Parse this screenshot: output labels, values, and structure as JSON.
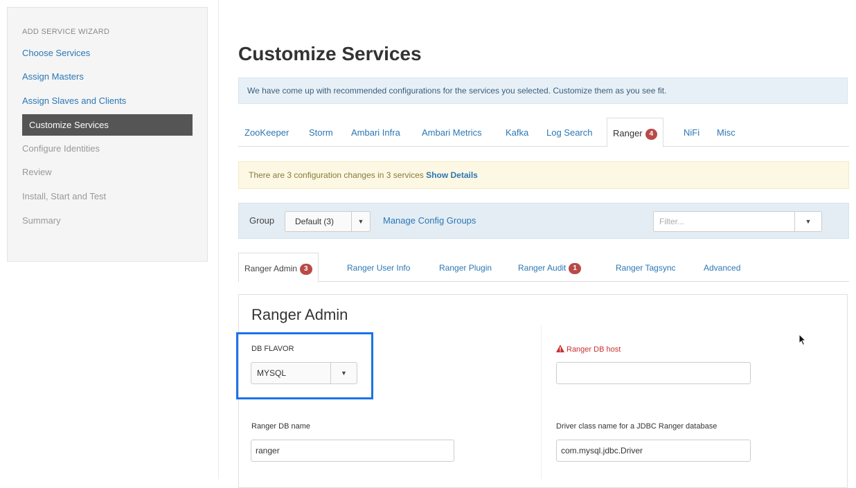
{
  "sidebar": {
    "title": "ADD SERVICE WIZARD",
    "steps": [
      {
        "label": "Choose Services",
        "state": "done"
      },
      {
        "label": "Assign Masters",
        "state": "done"
      },
      {
        "label": "Assign Slaves and Clients",
        "state": "done"
      },
      {
        "label": "Customize Services",
        "state": "active"
      },
      {
        "label": "Configure Identities",
        "state": "todo"
      },
      {
        "label": "Review",
        "state": "todo"
      },
      {
        "label": "Install, Start and Test",
        "state": "todo"
      },
      {
        "label": "Summary",
        "state": "todo"
      }
    ]
  },
  "page": {
    "title": "Customize Services",
    "info_alert": "We have come up with recommended configurations for the services you selected. Customize them as you see fit."
  },
  "service_tabs": [
    {
      "label": "ZooKeeper"
    },
    {
      "label": "Storm"
    },
    {
      "label": "Ambari Infra"
    },
    {
      "label": "Ambari Metrics"
    },
    {
      "label": "Kafka"
    },
    {
      "label": "Log Search"
    },
    {
      "label": "Ranger",
      "badge": "4",
      "active": true
    },
    {
      "label": "NiFi"
    },
    {
      "label": "Misc"
    }
  ],
  "changes_alert": {
    "text": "There are 3 configuration changes in 3 services",
    "link": "Show Details"
  },
  "group_bar": {
    "label": "Group",
    "selected": "Default (3)",
    "manage_link": "Manage Config Groups",
    "filter_placeholder": "Filter..."
  },
  "sub_tabs": [
    {
      "label": "Ranger Admin",
      "badge": "3",
      "active": true
    },
    {
      "label": "Ranger User Info"
    },
    {
      "label": "Ranger Plugin"
    },
    {
      "label": "Ranger Audit",
      "badge": "1"
    },
    {
      "label": "Ranger Tagsync"
    },
    {
      "label": "Advanced"
    }
  ],
  "ranger_admin": {
    "title": "Ranger Admin",
    "db_flavor_label": "DB FLAVOR",
    "db_flavor_value": "MYSQL",
    "db_host_label": "Ranger DB host",
    "db_host_value": "",
    "db_name_label": "Ranger DB name",
    "db_name_value": "ranger",
    "driver_label": "Driver class name for a JDBC Ranger database",
    "driver_value": "com.mysql.jdbc.Driver"
  },
  "colors": {
    "link": "#2a77b5",
    "badge": "#b94a48",
    "highlight": "#1a73e8",
    "error": "#c9302c"
  }
}
